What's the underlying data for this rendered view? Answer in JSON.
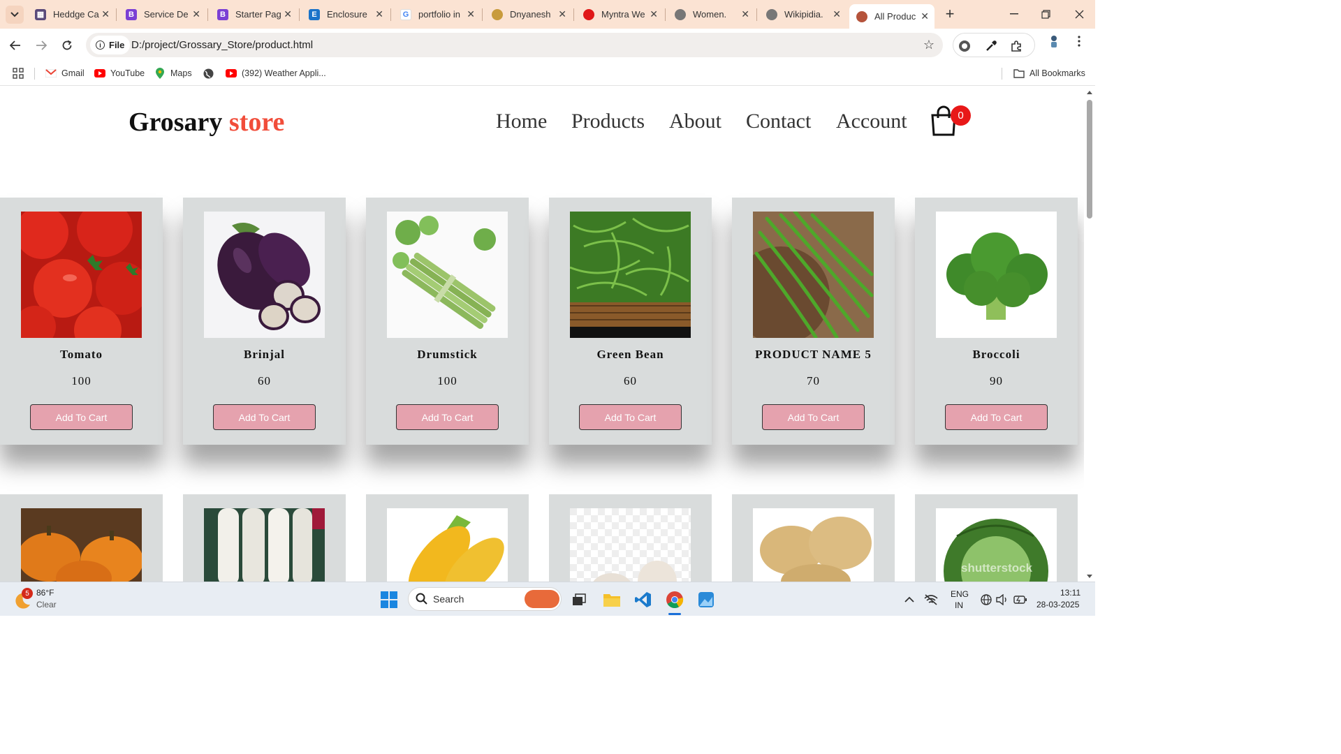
{
  "browser": {
    "tabs": [
      {
        "label": "Heddge Ca",
        "icon": "hedge-favicon"
      },
      {
        "label": "Service De",
        "icon": "bootstrap-favicon"
      },
      {
        "label": "Starter Pag",
        "icon": "bootstrap-favicon"
      },
      {
        "label": "Enclosure",
        "icon": "enclosure-favicon"
      },
      {
        "label": "portfolio in",
        "icon": "google-favicon"
      },
      {
        "label": "Dnyanesh",
        "icon": "portfolio-favicon"
      },
      {
        "label": "Myntra We",
        "icon": "myntra-favicon"
      },
      {
        "label": "Women.",
        "icon": "globe-favicon"
      },
      {
        "label": "Wikipidia.",
        "icon": "globe-favicon"
      },
      {
        "label": "All Produc",
        "icon": "store-favicon",
        "active": true
      }
    ],
    "address": {
      "chip_label": "File",
      "url": "D:/project/Grossary_Store/product.html"
    },
    "bookmarks": [
      {
        "label": "Gmail",
        "icon": "gmail-icon"
      },
      {
        "label": "YouTube",
        "icon": "youtube-icon"
      },
      {
        "label": "Maps",
        "icon": "maps-icon"
      },
      {
        "label": "",
        "icon": "globe-icon"
      },
      {
        "label": "(392) Weather Appli...",
        "icon": "youtube-icon"
      }
    ],
    "all_bookmarks_label": "All Bookmarks"
  },
  "site": {
    "logo_main": "Grosary",
    "logo_accent": "store",
    "nav": [
      "Home",
      "Products",
      "About",
      "Contact",
      "Account"
    ],
    "cart_count": "0",
    "accent_color": "#f14d3a",
    "button_color": "#e5a2ae"
  },
  "products": [
    {
      "name": "Tomato",
      "price": "100",
      "button": "Add To Cart"
    },
    {
      "name": "Brinjal",
      "price": "60",
      "button": "Add To Cart"
    },
    {
      "name": "Drumstick",
      "price": "100",
      "button": "Add To Cart"
    },
    {
      "name": "Green Bean",
      "price": "60",
      "button": "Add To Cart"
    },
    {
      "name": "PRODUCT NAME 5",
      "price": "70",
      "button": "Add To Cart"
    },
    {
      "name": "Broccoli",
      "price": "90",
      "button": "Add To Cart"
    }
  ],
  "products_row2": [
    {
      "image": "pumpkin"
    },
    {
      "image": "radish"
    },
    {
      "image": "corn"
    },
    {
      "image": "garlic"
    },
    {
      "image": "potato"
    },
    {
      "image": "cabbage"
    }
  ],
  "row2_watermark": "shutterstock",
  "taskbar": {
    "weather_temp": "86°F",
    "weather_desc": "Clear",
    "weather_badge": "5",
    "search_label": "Search",
    "lang_line1": "ENG",
    "lang_line2": "IN",
    "time": "13:11",
    "date": "28-03-2025"
  }
}
